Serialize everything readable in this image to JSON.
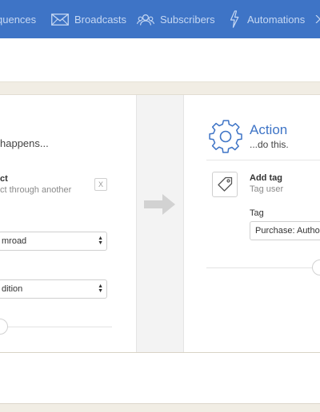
{
  "nav": {
    "items": [
      {
        "label": "quences",
        "icon": "sequences-icon"
      },
      {
        "label": "Broadcasts",
        "icon": "envelope-icon"
      },
      {
        "label": "Subscribers",
        "icon": "users-icon"
      },
      {
        "label": "Automations",
        "icon": "lightning-icon"
      }
    ],
    "color": "#3e74c6"
  },
  "trigger": {
    "subtitle": "happens...",
    "row_title": "ct",
    "row_desc": "ct through another",
    "remove_label": "X",
    "select_1": "mroad",
    "select_2": "dition"
  },
  "action": {
    "title": "Action",
    "subtitle": "...do this.",
    "add_tag_title": "Add tag",
    "add_tag_desc": "Tag user",
    "tag_label": "Tag",
    "tag_value": "Purchase: Author"
  },
  "accent": "#3e74c6"
}
